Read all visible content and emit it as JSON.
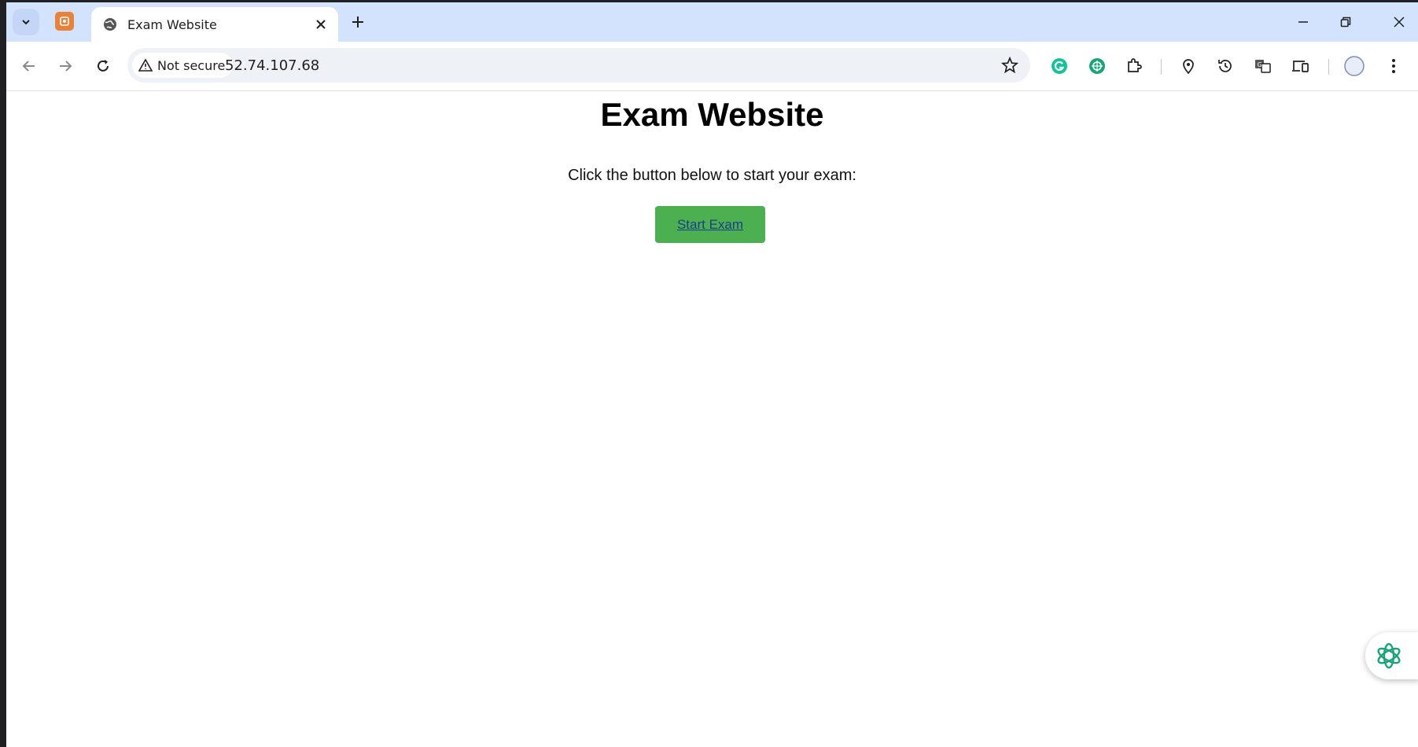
{
  "browser": {
    "tab": {
      "title": "Exam Website"
    },
    "address_bar": {
      "security_label": "Not secure",
      "url": "52.74.107.68"
    },
    "icons": {
      "tab_search": "chevron-down-icon",
      "pinned_tab": "app-favicon-icon",
      "tab_favicon": "globe-icon",
      "tab_close": "close-icon",
      "new_tab": "plus-icon",
      "back": "arrow-left-icon",
      "forward": "arrow-right-icon",
      "reload": "reload-icon",
      "warning": "warning-icon",
      "bookmark": "star-icon",
      "extensions": [
        "grammarly-icon",
        "chatgpt-icon",
        "puzzle-icon",
        "location-pin-icon",
        "history-icon",
        "translate-icon",
        "devices-icon",
        "profile-icon",
        "more-vert-icon"
      ]
    },
    "colors": {
      "tab_strip": "#d3e3fd",
      "omnibox": "#eef1f6",
      "accent_green": "#1aa37a"
    }
  },
  "page": {
    "heading": "Exam Website",
    "intro": "Click the button below to start your exam:",
    "start_button": "Start Exam",
    "button_color": "#4caf50"
  }
}
